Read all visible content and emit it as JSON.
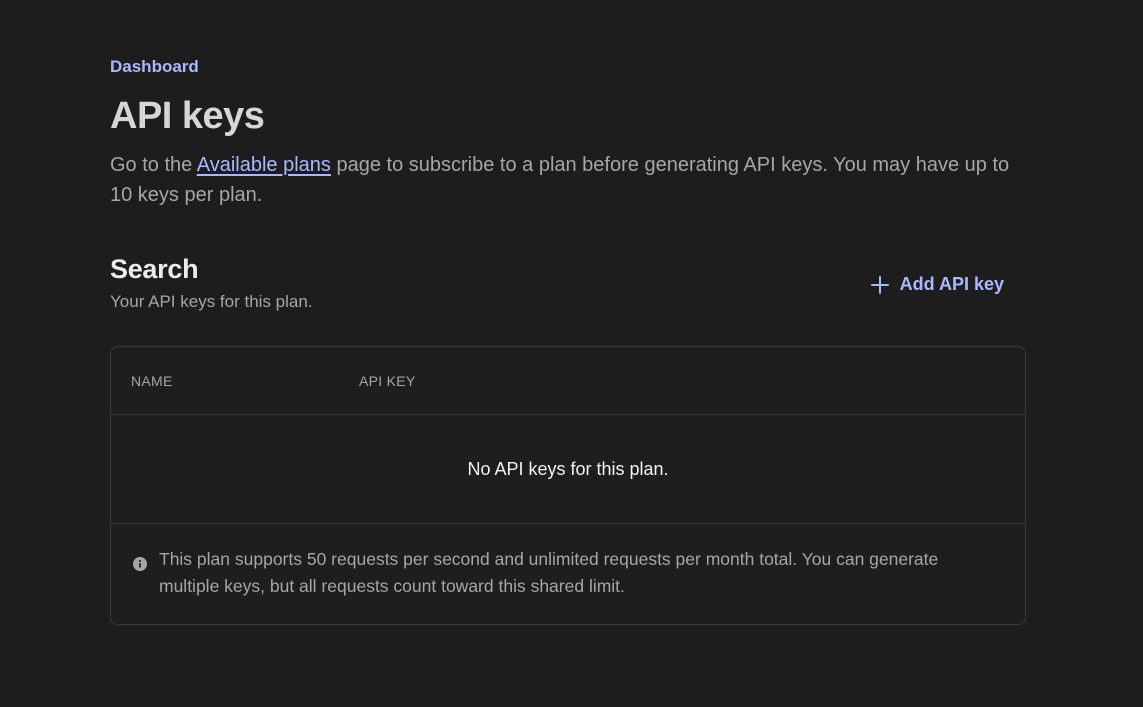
{
  "breadcrumb": {
    "label": "Dashboard"
  },
  "header": {
    "title": "API keys",
    "intro_before": "Go to the ",
    "intro_link": "Available plans",
    "intro_after": " page to subscribe to a plan before generating API keys. You may have up to 10 keys per plan."
  },
  "section": {
    "title": "Search",
    "subtitle": "Your API keys for this plan.",
    "add_button_label": "Add API key",
    "add_button_icon": "plus-icon"
  },
  "table": {
    "columns": [
      "NAME",
      "API KEY"
    ],
    "empty_message": "No API keys for this plan."
  },
  "note": {
    "icon": "info-icon",
    "text": "This plan supports 50 requests per second and unlimited requests per month total. You can generate multiple keys, but all requests count toward this shared limit."
  },
  "colors": {
    "background": "#1d1d1d",
    "accent": "#a9b9ff",
    "muted_text": "#a6a6a6",
    "border": "#3a3a3a"
  }
}
